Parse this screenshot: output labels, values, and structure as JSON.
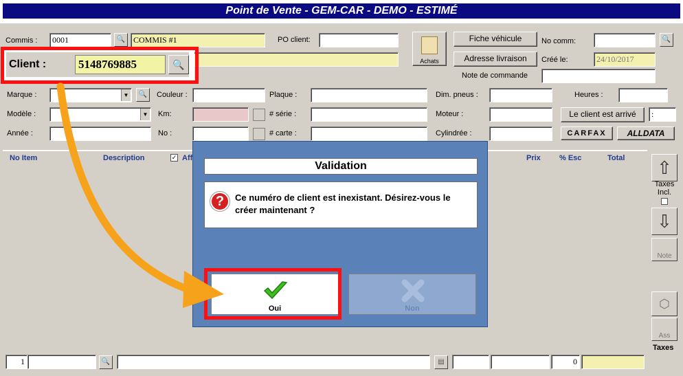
{
  "window": {
    "title": "Point de Vente - GEM-CAR - DEMO - ESTIMÉ"
  },
  "header": {
    "commis_label": "Commis :",
    "commis_code": "0001",
    "commis_name": "COMMIS #1",
    "po_label": "PO client:",
    "po_value": "",
    "achats_label": "Achats",
    "fiche_button": "Fiche véhicule",
    "adresse_button": "Adresse livraison",
    "note_label": "Note de commande",
    "nocomm_label": "No comm:",
    "nocomm_value": "",
    "cree_label": "Créé le:",
    "cree_value": "24/10/2017",
    "client_label": "Client :",
    "client_value": "5148769885"
  },
  "vehicle": {
    "marque_label": "Marque :",
    "modele_label": "Modèle :",
    "annee_label": "Année :",
    "couleur_label": "Couleur :",
    "km_label": "Km:",
    "no_label": "No :",
    "plaque_label": "Plaque :",
    "serie_label": "# série :",
    "carte_label": "# carte :",
    "dim_label": "Dim. pneus :",
    "moteur_label": "Moteur :",
    "cylindree_label": "Cylindrée :",
    "heures_label": "Heures :",
    "arrive_button": "Le client est arrivé",
    "arrive_value": ":",
    "carfax_label": "CARFAX",
    "alldata_label": "ALLDATA"
  },
  "grid": {
    "columns": [
      "No Item",
      "Description",
      "Aff",
      "Prix",
      "% Esc",
      "Total"
    ]
  },
  "side": {
    "taxes_incl": "Taxes Incl.",
    "note": "Note",
    "ass": "Ass",
    "taxes": "Taxes"
  },
  "status": {
    "line_count": "1",
    "total_count": "0"
  },
  "dialog": {
    "title": "Validation",
    "message": "Ce numéro de client est inexistant. Désirez-vous le créer maintenant ?",
    "yes_label": "Oui",
    "no_label": "Non"
  },
  "colors": {
    "title_bar": "#0a0a82",
    "dialog_bg": "#5a81b8",
    "highlight": "#ff1010",
    "arrow": "#f7a21b",
    "check": "#3fbf1f"
  }
}
